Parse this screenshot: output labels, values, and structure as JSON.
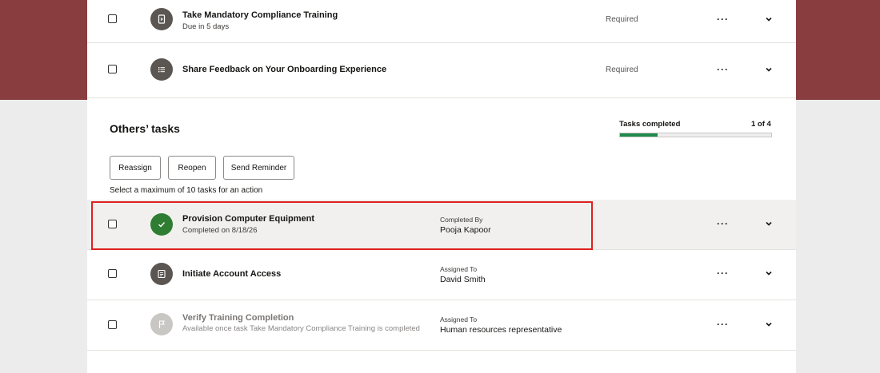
{
  "my_tasks": [
    {
      "title": "Take Mandatory Compliance Training",
      "subtitle": "Due in 5 days",
      "status": "Required",
      "icon": "document-icon"
    },
    {
      "title": "Share Feedback on Your Onboarding Experience",
      "status": "Required",
      "icon": "list-icon"
    }
  ],
  "others": {
    "title": "Others’ tasks",
    "progress": {
      "label": "Tasks completed",
      "count_text": "1 of 4",
      "fraction": 0.25,
      "color": "#1f8a4c"
    },
    "actions": {
      "reassign": "Reassign",
      "reopen": "Reopen",
      "send_reminder": "Send Reminder"
    },
    "helper": "Select a maximum of 10 tasks for an action",
    "tasks": [
      {
        "title": "Provision Computer Equipment",
        "subtitle": "Completed on 8/18/26",
        "assign_label": "Completed By",
        "assign_value": "Pooja Kapoor",
        "icon": "check-icon",
        "highlighted": true
      },
      {
        "title": "Initiate Account Access",
        "assign_label": "Assigned To",
        "assign_value": "David Smith",
        "icon": "task-icon"
      },
      {
        "title": "Verify Training Completion",
        "subtitle": "Available once task Take Mandatory Compliance Training is completed",
        "assign_label": "Assigned To",
        "assign_value": "Human resources representative",
        "icon": "flag-icon",
        "disabled": true
      }
    ]
  },
  "more_glyph": "···",
  "colors": {
    "banner": "#8a3d3f",
    "highlight_border": "#e02020",
    "completed": "#2f7d32"
  }
}
